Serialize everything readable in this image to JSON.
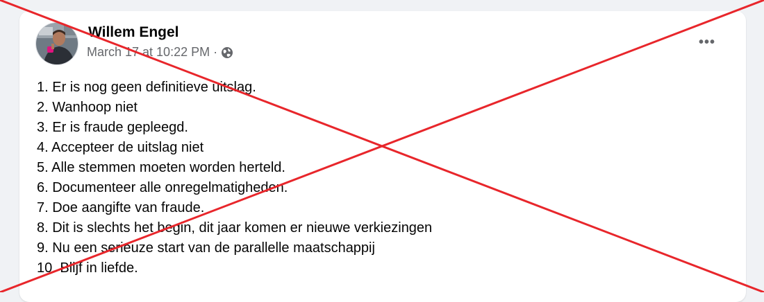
{
  "post": {
    "author": "Willem Engel",
    "timestamp": "March 17 at 10:22 PM",
    "separator": "·",
    "privacy_icon": "globe-icon",
    "more_options_label": "•••",
    "lines": [
      "1. Er is nog geen definitieve uitslag.",
      "2. Wanhoop niet",
      "3. Er is fraude gepleegd.",
      "4. Accepteer de uitslag niet",
      "5. Alle stemmen moeten worden herteld.",
      "6. Documenteer alle onregelmatigheden.",
      "7. Doe aangifte van fraude.",
      "8. Dit is slechts het begin, dit jaar komen er nieuwe verkiezingen",
      "9. Nu een serieuze start van de parallelle maatschappij",
      "10. Blijf in liefde."
    ]
  },
  "overlay": {
    "type": "red-cross",
    "color": "#e8262b"
  }
}
